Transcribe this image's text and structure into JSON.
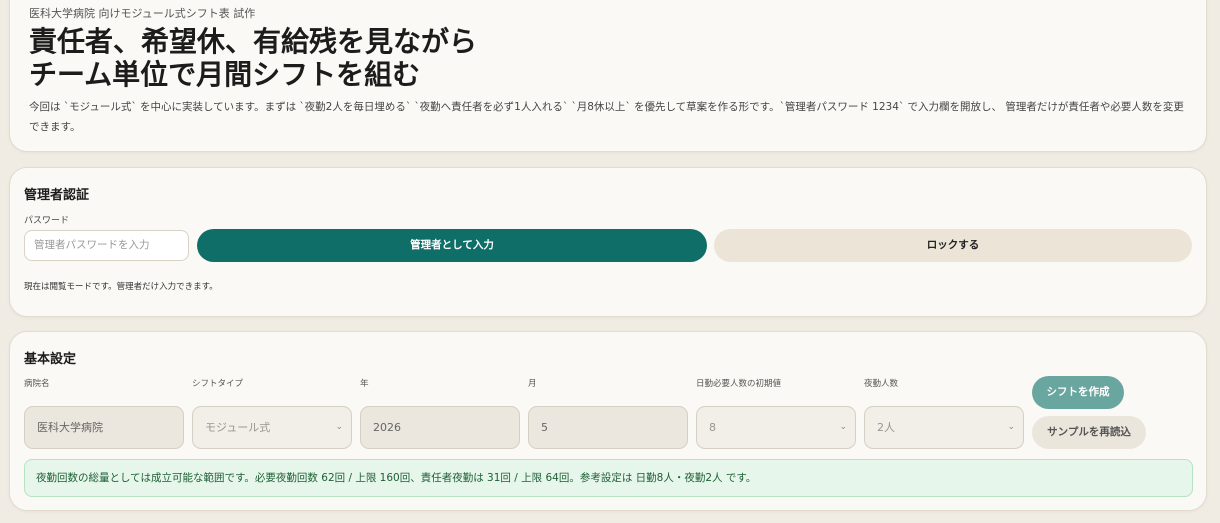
{
  "hero": {
    "eyebrow": "医科大学病院 向けモジュール式シフト表 試作",
    "title_line1": "責任者、希望休、有給残を見ながら",
    "title_line2": "チーム単位で月間シフトを組む",
    "description": "今回は `モジュール式` を中心に実装しています。まずは `夜勤2人を毎日埋める` `夜勤へ責任者を必ず1人入れる` `月8休以上` を優先して草案を作る形です。`管理者パスワード 1234` で入力欄を開放し、 管理者だけが責任者や必要人数を変更できます。"
  },
  "auth": {
    "title": "管理者認証",
    "password_label": "パスワード",
    "password_placeholder": "管理者パスワードを入力",
    "login_button": "管理者として入力",
    "lock_button": "ロックする",
    "mode_text": "現在は閲覧モードです。管理者だけ入力できます。"
  },
  "settings": {
    "title": "基本設定",
    "hospital_label": "病院名",
    "hospital_value": "医科大学病院",
    "shift_type_label": "シフトタイプ",
    "shift_type_value": "モジュール式",
    "year_label": "年",
    "year_value": "2026",
    "month_label": "月",
    "month_value": "5",
    "day_required_label": "日勤必要人数の初期値",
    "day_required_value": "8",
    "night_count_label": "夜勤人数",
    "night_count_value": "2人",
    "create_button": "シフトを作成",
    "reload_button": "サンプルを再読込",
    "notice": "夜勤回数の総量としては成立可能な範囲です。必要夜勤回数 62回 / 上限 160回、責任者夜勤は 31回 / 上限 64回。参考設定は 日勤8人・夜勤2人 です。"
  },
  "colors": {
    "primary": "#0f6e68",
    "primary_light": "#6aa6a0",
    "secondary": "#ebe4d7",
    "notice_bg": "#e6f6ea",
    "notice_text": "#1d5f35",
    "page_bg": "#f0ebe3"
  },
  "icons": {
    "select_chevron": "chevron-down-icon"
  }
}
